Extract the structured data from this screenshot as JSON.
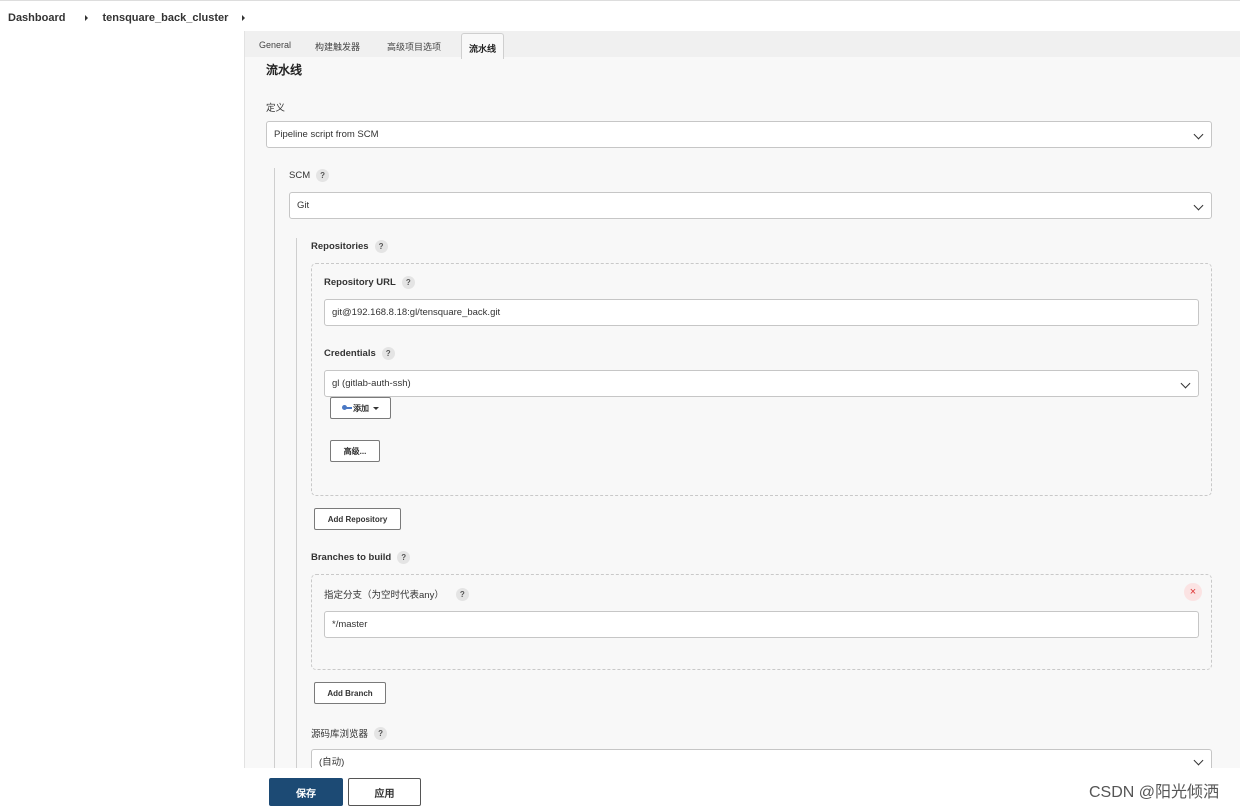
{
  "breadcrumb": {
    "items": [
      "Dashboard",
      "tensquare_back_cluster"
    ]
  },
  "tabs": [
    "General",
    "构建触发器",
    "高级项目选项",
    "流水线"
  ],
  "pipeline": {
    "title": "流水线",
    "definition_label": "定义",
    "definition_value": "Pipeline script from SCM",
    "scm_label": "SCM",
    "scm_value": "Git",
    "repositories_label": "Repositories",
    "repo_url_label": "Repository URL",
    "repo_url_value": "git@192.168.8.18:gl/tensquare_back.git",
    "credentials_label": "Credentials",
    "credentials_value": "gl (gitlab-auth-ssh)",
    "add_label": "添加",
    "advanced_label": "高级...",
    "add_repository_label": "Add Repository",
    "branches_label": "Branches to build",
    "branch_specifier_label": "指定分支（为空时代表any）",
    "branch_value": "*/master",
    "add_branch_label": "Add Branch",
    "repo_browser_label": "源码库浏览器",
    "repo_browser_value": "(自动)"
  },
  "help_glyph": "?",
  "close_glyph": "×",
  "footer": {
    "save_label": "保存",
    "apply_label": "应用"
  },
  "watermark": "CSDN @阳光倾洒"
}
